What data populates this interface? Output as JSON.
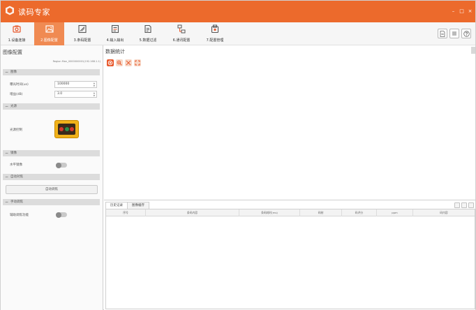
{
  "app": {
    "title": "读码专家",
    "window": {
      "minimize": "–",
      "maximize": "□",
      "close": "×"
    }
  },
  "toolbar": {
    "items": [
      {
        "label": "1.设备连接",
        "icon": "camera-icon"
      },
      {
        "label": "2.图像配置",
        "icon": "image-icon",
        "active": true
      },
      {
        "label": "3.条码配置",
        "icon": "barcode-icon"
      },
      {
        "label": "4.输入输出",
        "icon": "io-icon"
      },
      {
        "label": "5.数据过滤",
        "icon": "filter-icon"
      },
      {
        "label": "6.通讯配置",
        "icon": "network-icon"
      },
      {
        "label": "7.配置管理",
        "icon": "settings-manage-icon"
      }
    ],
    "right_icons": [
      "document-icon",
      "list-icon",
      "help-icon"
    ]
  },
  "left": {
    "title": "图像配置",
    "device": "Region Man_0000000001(192.168.1.1)",
    "sections": {
      "image": "图像",
      "light": "光源",
      "mirror": "镜像",
      "autofocus": "自动对焦",
      "manual": "手动调焦"
    },
    "exposure": {
      "label": "曝光时间(us)",
      "value": "100000"
    },
    "gain": {
      "label": "增益(dB)",
      "value": "3.0"
    },
    "light_control": {
      "label": "光源控制"
    },
    "horizontal_mirror": {
      "label": "水平镜像"
    },
    "auto_focus_button": "自动调焦",
    "assist_focus": {
      "label": "辅助调焦功能"
    }
  },
  "right": {
    "title": "数据统计",
    "chart_tools": [
      "record-icon",
      "zoom-in-icon",
      "zoom-out-icon",
      "fit-icon"
    ],
    "tabs": [
      "历史记录",
      "图像缓存"
    ],
    "table": {
      "columns": [
        "序号",
        "条码内容",
        "条码耗时(ms)",
        "码制",
        "码评分",
        "ppm",
        "码内容"
      ]
    }
  },
  "colors": {
    "accent": "#ec6a2c",
    "active_tool": "#f08a52",
    "record_icon": "#e8572a"
  }
}
